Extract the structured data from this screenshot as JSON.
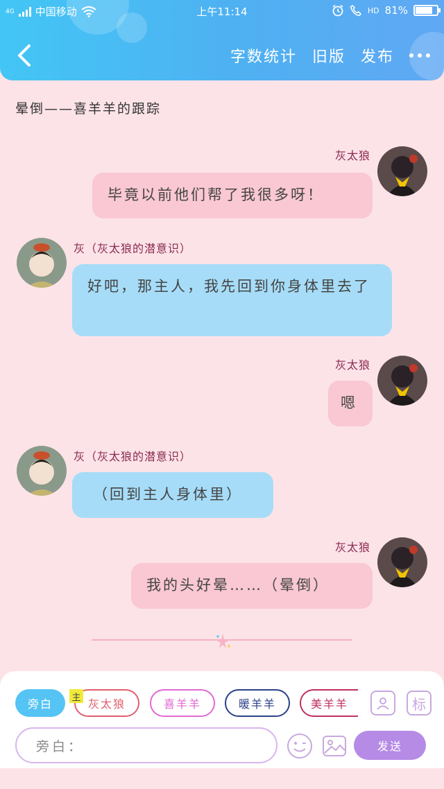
{
  "status_bar": {
    "network": "4G",
    "carrier": "中国移动",
    "time": "上午11:14",
    "hd": "HD",
    "battery": "81%",
    "battery_level": 0.81
  },
  "nav": {
    "actions": [
      "字数统计",
      "旧版",
      "发布"
    ]
  },
  "chapter_title": "晕倒——喜羊羊的跟踪",
  "messages": [
    {
      "side": "right",
      "name": "灰太狼",
      "text": "毕竟以前他们帮了我很多呀！",
      "style": "pink"
    },
    {
      "side": "left",
      "name": "灰（灰太狼的潜意识）",
      "text": "好吧，那主人，我先回到你身体里去了",
      "style": "blue"
    },
    {
      "side": "right",
      "name": "灰太狼",
      "text": "嗯",
      "style": "pink"
    },
    {
      "side": "left",
      "name": "灰（灰太狼的潜意识）",
      "text": "（回到主人身体里）",
      "style": "blue"
    },
    {
      "side": "right",
      "name": "灰太狼",
      "text": "我的头好晕……（晕倒）",
      "style": "pink"
    }
  ],
  "roles": [
    {
      "label": "旁白",
      "color": "#55c4f4",
      "active": true
    },
    {
      "label": "灰太狼",
      "color": "#e0606e",
      "active": false
    },
    {
      "label": "喜羊羊",
      "color": "#e06ad0",
      "active": false
    },
    {
      "label": "暖羊羊",
      "color": "#2a3f88",
      "active": false
    },
    {
      "label": "美羊羊",
      "color": "#c0305e",
      "active": false
    }
  ],
  "main_tag": "主",
  "tools": {
    "character_icon": "user-card-icon",
    "mark_label": "标"
  },
  "input": {
    "placeholder": "旁白："
  },
  "send_label": "发送",
  "colors": {
    "header": "#4fb0f2",
    "background": "#fce3e8",
    "pink_bubble": "#f9c8d2",
    "blue_bubble": "#a6dcf7",
    "send": "#b58be6"
  }
}
